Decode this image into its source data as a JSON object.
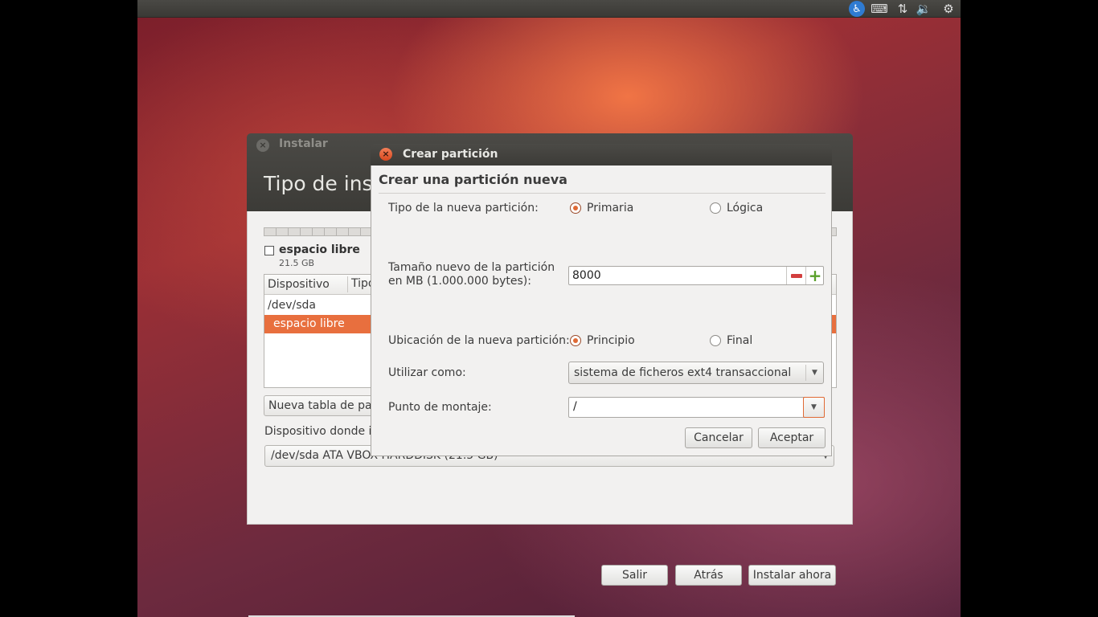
{
  "panel": {
    "accessibility_icon": "♿",
    "keyboard_icon": "⌨",
    "network_icon": "⇅",
    "volume_icon": "🔉",
    "session_icon": "⚙"
  },
  "installer": {
    "title": "Instalar",
    "heading": "Tipo de inst",
    "free_space": {
      "title": "espacio libre",
      "size": "21.5 GB"
    },
    "table": {
      "headers": [
        "Dispositivo",
        "Tipo"
      ],
      "rows": [
        "/dev/sda",
        "espacio libre"
      ]
    },
    "new_table_button": "Nueva tabla de part",
    "boot_device_label": "Dispositivo donde in",
    "boot_device_value": "/dev/sda  ATA VBOX HARDDISK (21.5 GB)",
    "buttons": {
      "quit": "Salir",
      "back": "Atrás",
      "install_now": "Instalar ahora"
    }
  },
  "dialog": {
    "title": "Crear partición",
    "heading": "Crear una partición nueva",
    "type_label": "Tipo de la nueva partición:",
    "type_options": [
      "Primaria",
      "Lógica"
    ],
    "type_selected": "Primaria",
    "size_label_line1": "Tamaño nuevo de la partición",
    "size_label_line2": "en MB (1.000.000 bytes):",
    "size_value": "8000",
    "location_label": "Ubicación de la nueva partición:",
    "location_options": [
      "Principio",
      "Final"
    ],
    "location_selected": "Principio",
    "use_label": "Utilizar como:",
    "use_value": "sistema de ficheros ext4 transaccional",
    "mount_label": "Punto de montaje:",
    "mount_value": "/",
    "buttons": {
      "cancel": "Cancelar",
      "accept": "Aceptar"
    }
  },
  "colors": {
    "accent": "#e86f3e",
    "titlebar": "#3c3b37",
    "window_bg": "#f2f1f0"
  }
}
